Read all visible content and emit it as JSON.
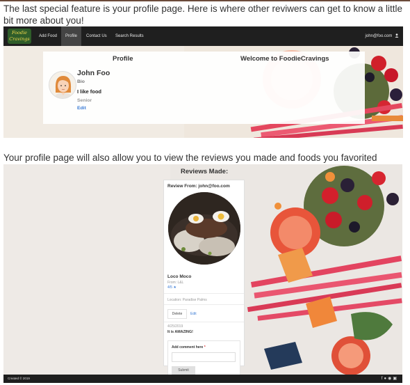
{
  "captions": {
    "first": "The last special feature is your profile page. Here is where other reviwers can get to know a little bit more about you!",
    "second": "Your profile page will also allow you to view the reviews you made and foods you favorited"
  },
  "navbar": {
    "logo_line1": "Foodie",
    "logo_line2": "Cravings",
    "items": [
      "Add Food",
      "Profile",
      "Contact Us",
      "Search Results"
    ],
    "active_item": "Profile",
    "user_email": "john@foo.com"
  },
  "profile": {
    "heading": "Profile",
    "welcome": "Welcome to FoodieCravings",
    "name": "John Foo",
    "bio_label": "Bio",
    "bio": "I like food",
    "level": "Senior",
    "edit_label": "Edit"
  },
  "reviews": {
    "heading": "Reviews Made:",
    "card": {
      "title": "Review From: john@foo.com",
      "food_name": "Loco Moco",
      "from": "From: L&L",
      "rating": "4/5",
      "location": "Location: Paradise Palms",
      "delete_label": "Delete",
      "edit_label": "Edit",
      "date": "4/25/2019",
      "text": "It is AMAZING!",
      "comment_label": "Add comment here",
      "comment_required_mark": "*",
      "comment_value": "",
      "submit_label": "Submit"
    }
  },
  "footer": {
    "text": "Created © 2019",
    "icons": [
      "facebook-icon",
      "twitter-icon",
      "pinterest-icon",
      "instagram-icon"
    ]
  },
  "colors": {
    "navbar": "#1f1f1f",
    "link": "#3a7bd5",
    "logo_bg": "#2f5d2a",
    "logo_text": "#f2d94e"
  }
}
